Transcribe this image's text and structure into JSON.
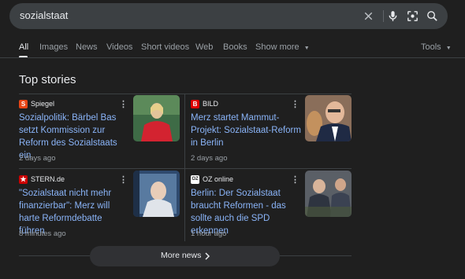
{
  "search": {
    "query": "sozialstaat"
  },
  "tabs": [
    {
      "label": "All",
      "active": true
    },
    {
      "label": "Images"
    },
    {
      "label": "News"
    },
    {
      "label": "Videos"
    },
    {
      "label": "Short videos"
    },
    {
      "label": "Web"
    },
    {
      "label": "Books"
    },
    {
      "label": "Show more"
    }
  ],
  "tools_label": "Tools",
  "section_title": "Top stories",
  "stories": [
    {
      "source": "Spiegel",
      "favicon": "S",
      "favicon_color": "#e64415",
      "headline": "Sozialpolitik: Bärbel Bas setzt Kommission zur Reform des Sozialstaats ein",
      "age": "2 days ago"
    },
    {
      "source": "BILD",
      "favicon": "B",
      "favicon_color": "#dd0000",
      "headline": "Merz startet Mammut-Projekt: Sozialstaat-Reform in Berlin",
      "age": "2 days ago"
    },
    {
      "source": "STERN.de",
      "favicon": "★",
      "favicon_color": "#cc0000",
      "headline": "\"Sozialstaat nicht mehr finanzierbar\": Merz will harte Reformdebatte führen",
      "age": "8 minutes ago"
    },
    {
      "source": "OZ online",
      "favicon": "OZ",
      "favicon_color": "#ffffff",
      "headline": "Berlin: Der Sozialstaat braucht Reformen - das sollte auch die SPD erkennen",
      "age": "1 hour ago"
    }
  ],
  "more_news_label": "More news",
  "colors": {
    "background": "#1f1f1f",
    "link": "#8ab4f8",
    "muted": "#9aa0a6"
  }
}
